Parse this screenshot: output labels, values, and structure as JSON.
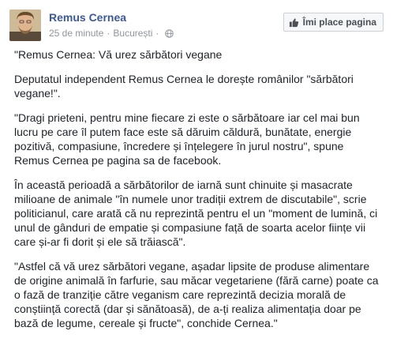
{
  "author": {
    "name": "Remus Cernea",
    "timestamp": "25 de minute",
    "location": "București",
    "separator": "·",
    "privacy_icon": "globe-icon"
  },
  "like_page_button": {
    "label": "Îmi place pagina",
    "icon": "thumbs-up-icon"
  },
  "post": {
    "paragraphs": [
      "\"Remus Cernea: Vă urez sărbători vegane",
      "Deputatul independent Remus Cernea le dorește românilor \"sărbători vegane!\".",
      "\"Dragi prieteni, pentru mine fiecare zi este o sărbătoare iar cel mai bun lucru pe care îl putem face este să dăruim căldură, bunătate, energie pozitivă, compasiune, încredere și înțelegere în jurul nostru\", spune Remus Cernea pe pagina sa de facebook.",
      "În această perioadă a sărbătorilor de iarnă sunt chinuite și masacrate milioane de animale \"în numele unor tradiții extrem de discutabile\", scrie politicianul, care arată că nu reprezintă pentru el un \"moment de lumină, ci unul de gânduri de empatie și compasiune față de soarta acelor ființe vii care și-ar fi dorit și ele să trăiască\".",
      "\"Astfel că vă urez sărbători vegane, așadar lipsite de produse alimentare de origine animală în farfurie, sau măcar vegetariene (fără carne) poate ca o fază de tranziție către veganism care reprezintă decizia morală de conștiință corectă (dar și sănătoasă), de a-ți realiza alimentația doar pe bază de legume, cereale și fructe\", conchide Cernea.\""
    ]
  },
  "colors": {
    "link_blue": "#3b5998",
    "meta_gray": "#90949c",
    "text": "#1d2129",
    "button_bg": "#f6f7f9",
    "button_border": "#ced0d4"
  }
}
